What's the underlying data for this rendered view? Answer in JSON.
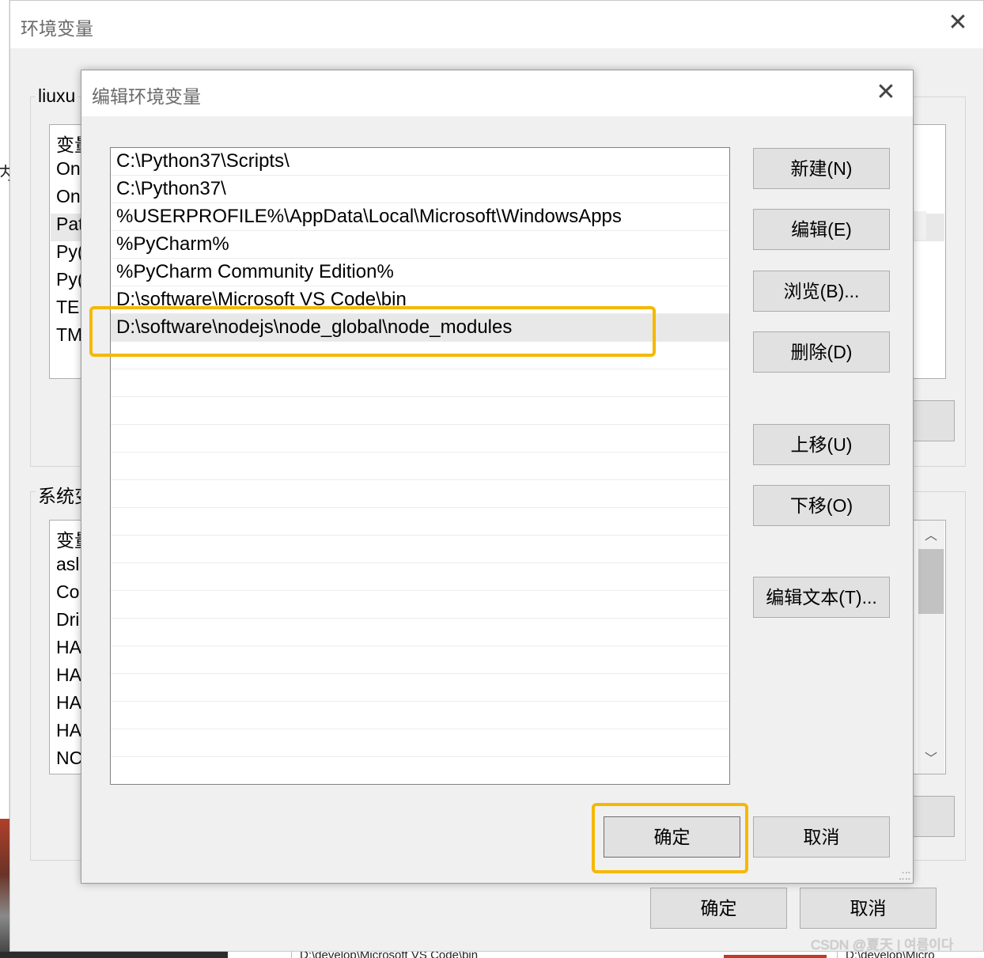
{
  "outer_window": {
    "title": "环境变量",
    "user_group_label": "liuxu",
    "system_group_label": "系统变",
    "user_list_rows": [
      "变量",
      "On",
      "On",
      "Pat",
      "Py(",
      "Py(",
      "TEI",
      "TM"
    ],
    "system_list_rows": [
      "变量",
      "asl.",
      "Co",
      "Dri",
      "HA",
      "HA",
      "HA",
      "HA",
      "NC"
    ],
    "ok_label": "确定",
    "cancel_label": "取消",
    "left_fragment": "内"
  },
  "dialog": {
    "title": "编辑环境变量",
    "paths": [
      "C:\\Python37\\Scripts\\",
      "C:\\Python37\\",
      "%USERPROFILE%\\AppData\\Local\\Microsoft\\WindowsApps",
      "%PyCharm%",
      "%PyCharm Community Edition%",
      "D:\\software\\Microsoft VS Code\\bin",
      "D:\\software\\nodejs\\node_global\\node_modules"
    ],
    "selected_index": 6,
    "buttons": {
      "new": "新建(N)",
      "edit": "编辑(E)",
      "browse": "浏览(B)...",
      "delete": "删除(D)",
      "move_up": "上移(U)",
      "move_down": "下移(O)",
      "edit_text": "编辑文本(T)...",
      "ok": "确定",
      "cancel": "取消"
    }
  },
  "background": {
    "bottom_text_left": "D:\\develop\\Microsoft VS Code\\bin",
    "bottom_text_right": "D:\\develop\\Micro"
  },
  "watermark": "CSDN @夏天 | 여름이다",
  "colors": {
    "highlight": "#f5b800",
    "selected_row": "#e8e8e8",
    "button_face": "#e1e1e1",
    "window_face": "#f0f0f0"
  }
}
